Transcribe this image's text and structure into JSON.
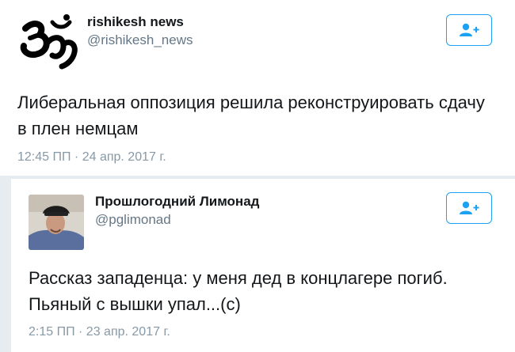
{
  "tweets": [
    {
      "name": "rishikesh news",
      "handle": "@rishikesh_news",
      "text": "Либеральная оппозиция решила реконструировать сдачу в плен немцам",
      "time": "12:45 ПП · 24 апр. 2017 г.",
      "avatar_icon": "om-symbol-icon",
      "follow_icon": "add-user-icon"
    },
    {
      "name": "Прошлогодний Лимонад",
      "handle": "@pglimonad",
      "text": "Рассказ западенца: у меня дед в концлагере погиб. Пьяный с вышки упал...(с)",
      "time": "2:15 ПП · 23 апр. 2017 г.",
      "avatar_icon": "profile-photo",
      "follow_icon": "add-user-icon"
    }
  ],
  "colors": {
    "accent": "#1da1f2",
    "secondary_text": "#657786",
    "timestamp": "#8899a6",
    "primary_text": "#14171a"
  }
}
